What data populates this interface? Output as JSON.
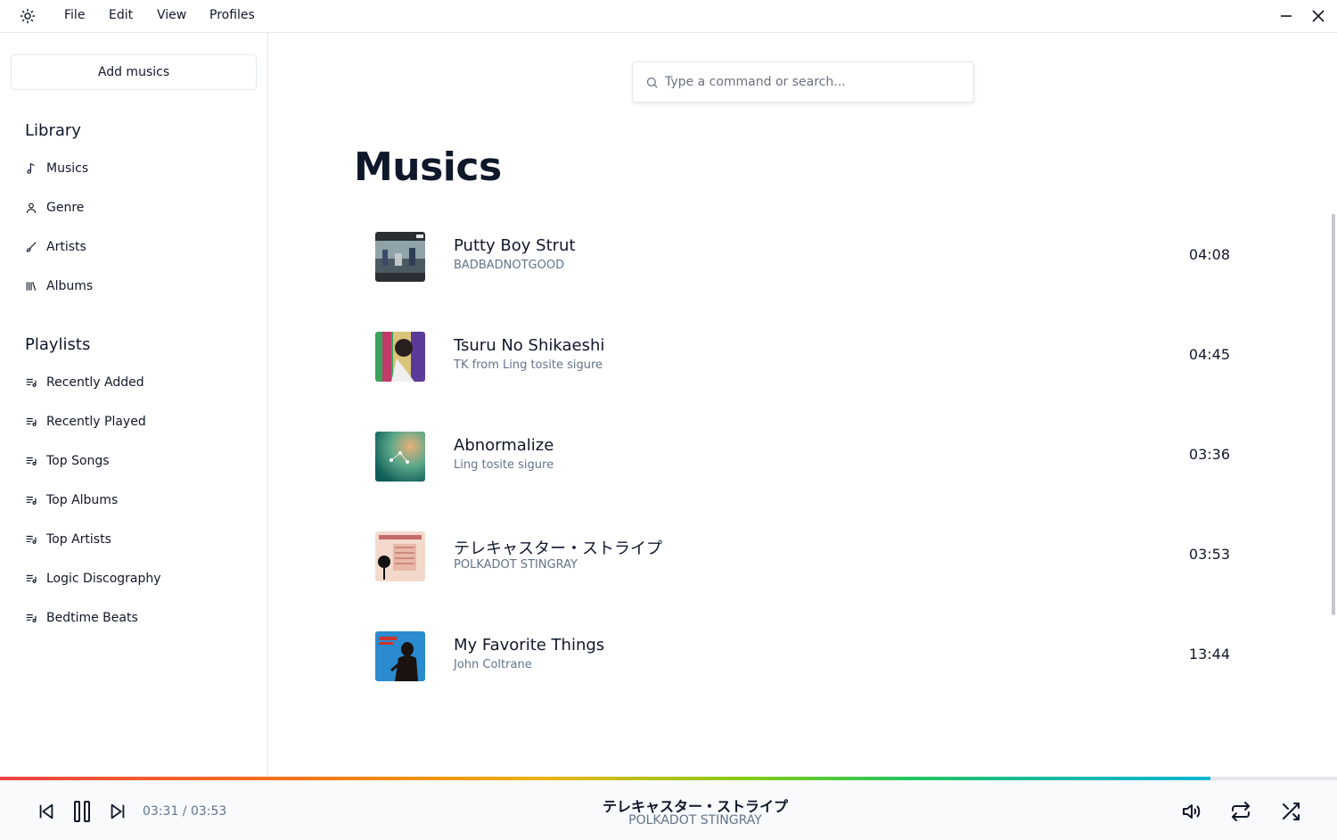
{
  "menu": {
    "file": "File",
    "edit": "Edit",
    "view": "View",
    "profiles": "Profiles"
  },
  "sidebar": {
    "add_button": "Add musics",
    "library_title": "Library",
    "library_items": [
      {
        "label": "Musics",
        "icon": "music-note-icon"
      },
      {
        "label": "Genre",
        "icon": "user-icon"
      },
      {
        "label": "Artists",
        "icon": "brush-icon"
      },
      {
        "label": "Albums",
        "icon": "library-icon"
      }
    ],
    "playlists_title": "Playlists",
    "playlists": [
      {
        "label": "Recently Added"
      },
      {
        "label": "Recently Played"
      },
      {
        "label": "Top Songs"
      },
      {
        "label": "Top Albums"
      },
      {
        "label": "Top Artists"
      },
      {
        "label": "Logic Discography"
      },
      {
        "label": "Bedtime Beats"
      }
    ]
  },
  "search": {
    "placeholder": "Type a command or search..."
  },
  "main": {
    "title": "Musics",
    "tracks": [
      {
        "title": "Putty Boy Strut",
        "artist": "BADBADNOTGOOD",
        "duration": "04:08"
      },
      {
        "title": "Tsuru No Shikaeshi",
        "artist": "TK from Ling tosite sigure",
        "duration": "04:45"
      },
      {
        "title": "Abnormalize",
        "artist": "Ling tosite sigure",
        "duration": "03:36"
      },
      {
        "title": "テレキャスター・ストライプ",
        "artist": "POLKADOT STINGRAY",
        "duration": "03:53"
      },
      {
        "title": "My Favorite Things",
        "artist": "John Coltrane",
        "duration": "13:44"
      }
    ]
  },
  "player": {
    "time": "03:31 / 03:53",
    "progress": 0.905,
    "now_title": "テレキャスター・ストライプ",
    "now_artist": "POLKADOT STINGRAY"
  }
}
